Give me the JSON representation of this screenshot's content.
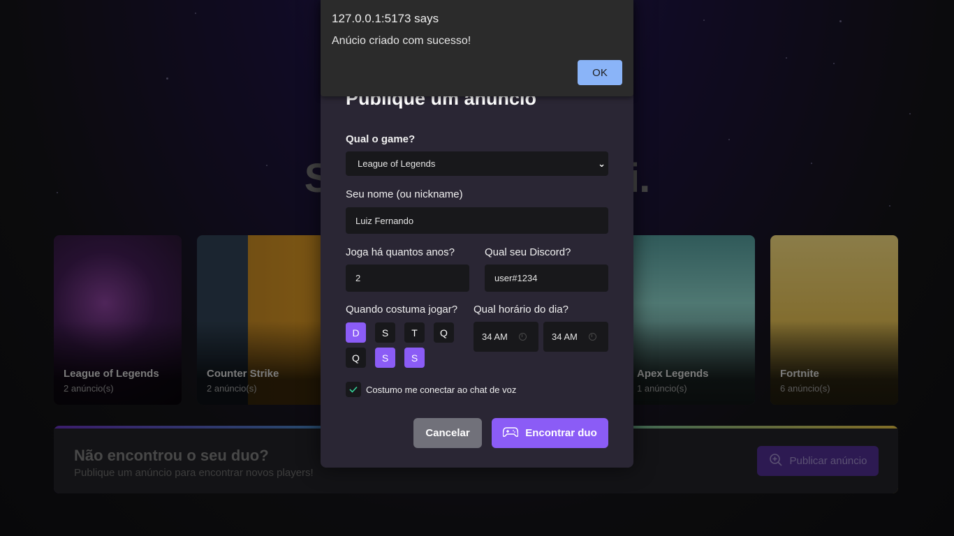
{
  "hero": {
    "title": "Seu duo está aqui."
  },
  "games": [
    {
      "name": "League of Legends",
      "count": "2 anúncio(s)"
    },
    {
      "name": "Counter Strike",
      "count": "2 anúncio(s)"
    },
    {
      "name": "Apex Legends",
      "count": "1 anúncio(s)"
    },
    {
      "name": "Fortnite",
      "count": "6 anúncio(s)"
    }
  ],
  "banner": {
    "title": "Não encontrou o seu duo?",
    "subtitle": "Publique um anúncio para encontrar novos players!",
    "button_label": "Publicar anúncio"
  },
  "modal": {
    "title": "Publique um anúncio",
    "game_label": "Qual o game?",
    "game_value": "League of Legends",
    "name_label": "Seu nome (ou nickname)",
    "name_value": "Luiz Fernando",
    "years_label": "Joga há quantos anos?",
    "years_value": "2",
    "discord_label": "Qual seu Discord?",
    "discord_value": "user#1234",
    "days_label": "Quando costuma jogar?",
    "days": [
      {
        "label": "D",
        "selected": true
      },
      {
        "label": "S",
        "selected": false
      },
      {
        "label": "T",
        "selected": false
      },
      {
        "label": "Q",
        "selected": false
      },
      {
        "label": "Q",
        "selected": false
      },
      {
        "label": "S",
        "selected": true
      },
      {
        "label": "S",
        "selected": true
      }
    ],
    "hours_label": "Qual horário do dia?",
    "hour_start": "34  AM",
    "hour_end": "34  AM",
    "voice_label": "Costumo me conectar ao chat de voz",
    "voice_checked": true,
    "cancel_label": "Cancelar",
    "submit_label": "Encontrar duo"
  },
  "alert": {
    "title": "127.0.0.1:5173 says",
    "message": "Anúcio criado com sucesso!",
    "ok_label": "OK"
  },
  "colors": {
    "accent": "#8b5cf6",
    "background": "#121214",
    "check": "#34d399",
    "ok_button": "#8ab4f8"
  },
  "icons": [
    "gamepad-icon",
    "magnifier-plus-icon",
    "check-icon",
    "clock-icon",
    "chevron-down-icon"
  ]
}
